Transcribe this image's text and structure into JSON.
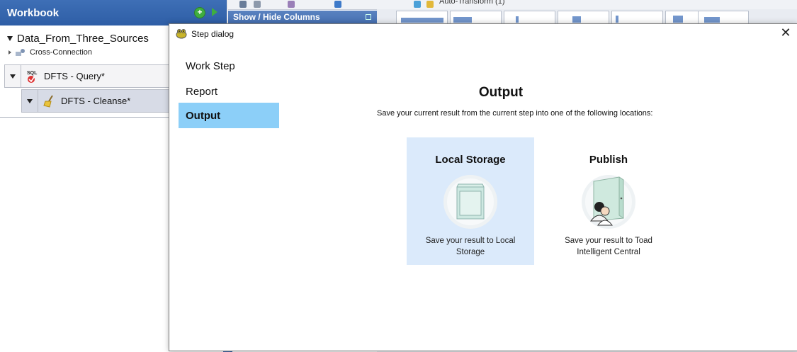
{
  "workbook": {
    "title": "Workbook",
    "root_name": "Data_From_Three_Sources",
    "sub_item": "Cross-Connection",
    "nodes": [
      {
        "label": "DFTS - Query*",
        "icon": "sql-icon"
      },
      {
        "label": "DFTS - Cleanse*",
        "icon": "broom-icon"
      }
    ]
  },
  "background": {
    "columns_panel_title": "Show / Hide Columns",
    "toolbar_text": "Auto-Transform (1)"
  },
  "dialog": {
    "title": "Step dialog",
    "nav": [
      {
        "label": "Work Step",
        "active": false
      },
      {
        "label": "Report",
        "active": false
      },
      {
        "label": "Output",
        "active": true
      }
    ],
    "heading": "Output",
    "subtitle": "Save your current result from the current step into one of the following locations:",
    "options": [
      {
        "title": "Local Storage",
        "description": "Save your result to Local Storage",
        "icon": "local-storage-icon",
        "selected": true
      },
      {
        "title": "Publish",
        "description": "Save your result to Toad Intelligent Central",
        "icon": "publish-icon",
        "selected": false
      }
    ]
  },
  "colors": {
    "header_blue": "#2e5ea6",
    "active_nav": "#8ccff8",
    "selected_card": "#dbeafb"
  }
}
